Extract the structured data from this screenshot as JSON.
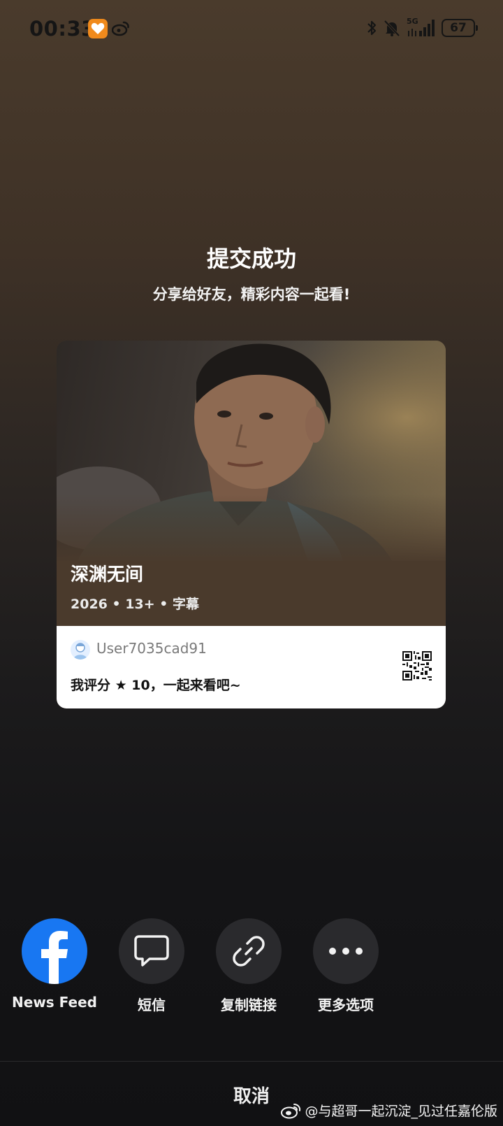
{
  "status_bar": {
    "time": "00:33",
    "network": "5G",
    "battery": "67"
  },
  "header": {
    "title": "提交成功",
    "subtitle": "分享给好友，精彩内容一起看!"
  },
  "card": {
    "movie_title": "深渊无间",
    "meta": "2026 • 13+ • 字幕",
    "username": "User7035cad91",
    "rating_text": "我评分 ★ 10，一起来看吧~"
  },
  "share_options": [
    {
      "label": "News Feed",
      "icon": "facebook-icon"
    },
    {
      "label": "短信",
      "icon": "message-bubble-icon"
    },
    {
      "label": "复制链接",
      "icon": "link-icon"
    },
    {
      "label": "更多选项",
      "icon": "more-dots-icon"
    }
  ],
  "cancel_label": "取消",
  "watermark": "@与超哥一起沉淀_见过任嘉伦版",
  "colors": {
    "facebook": "#1877f2",
    "app_badge": "#f08a1c"
  }
}
